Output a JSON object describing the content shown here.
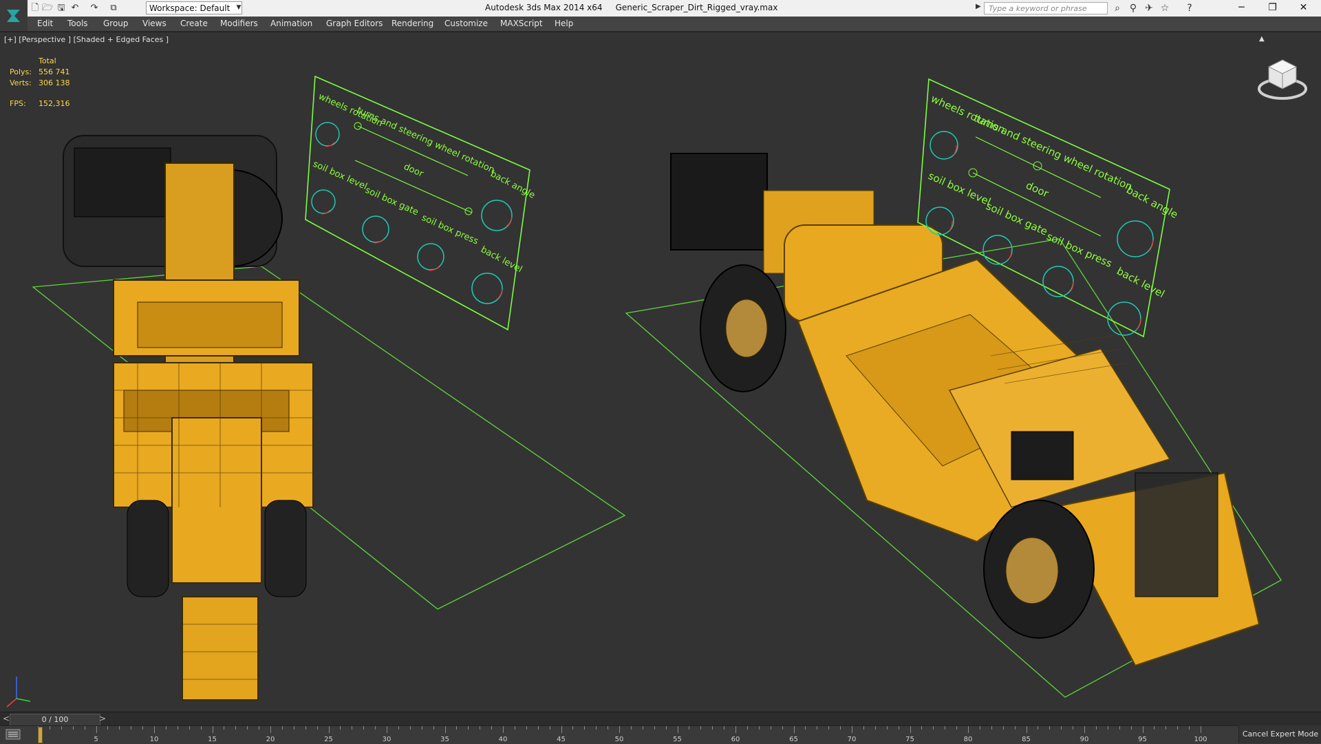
{
  "titlebar": {
    "workspace": "Workspace: Default",
    "app_title": "Autodesk 3ds Max  2014 x64",
    "file_title": "Generic_Scraper_Dirt_Rigged_vray.max",
    "search_placeholder": "Type a keyword or phrase"
  },
  "menu": [
    "Edit",
    "Tools",
    "Group",
    "Views",
    "Create",
    "Modifiers",
    "Animation",
    "Graph Editors",
    "Rendering",
    "Customize",
    "MAXScript",
    "Help"
  ],
  "viewport": {
    "label": "[+] [Perspective ] [Shaded + Edged Faces ]",
    "stats": {
      "total_label": "Total",
      "polys_label": "Polys:",
      "polys_value": "556 741",
      "verts_label": "Verts:",
      "verts_value": "306 138",
      "fps_label": "FPS:",
      "fps_value": "152,316"
    },
    "panel_left": {
      "wheels_rotation": "wheels rotation",
      "turns": "turns and steering wheel rotation",
      "back_angle": "back angle",
      "door": "door",
      "soil_box_level": "soil box level",
      "soil_box_gate": "soil box gate",
      "soil_box_press": "soil box press",
      "back_level": "back level"
    },
    "panel_right": {
      "wheels_rotation": "wheels rotation",
      "turns": "turns and steering wheel rotation",
      "back_angle": "back angle",
      "door": "door",
      "soil_box_level": "soil box level",
      "soil_box_gate": "soil box gate",
      "soil_box_press": "soil box press",
      "back_level": "back level"
    }
  },
  "timeline": {
    "frame": "0 / 100",
    "prev": "<",
    "next": ">",
    "ticks": [
      "5",
      "10",
      "15",
      "20",
      "25",
      "30",
      "35",
      "40",
      "45",
      "50",
      "55",
      "60",
      "65",
      "70",
      "75",
      "80",
      "85",
      "90",
      "95",
      "100"
    ],
    "cancel_expert": "Cancel Expert Mode"
  },
  "colors": {
    "panel_green": "#7cff3c",
    "label_green": "#8cff3c",
    "machine_yellow": "#e8a820",
    "grid_green": "#5ed63a",
    "stats_yellow": "#ffd84a"
  }
}
